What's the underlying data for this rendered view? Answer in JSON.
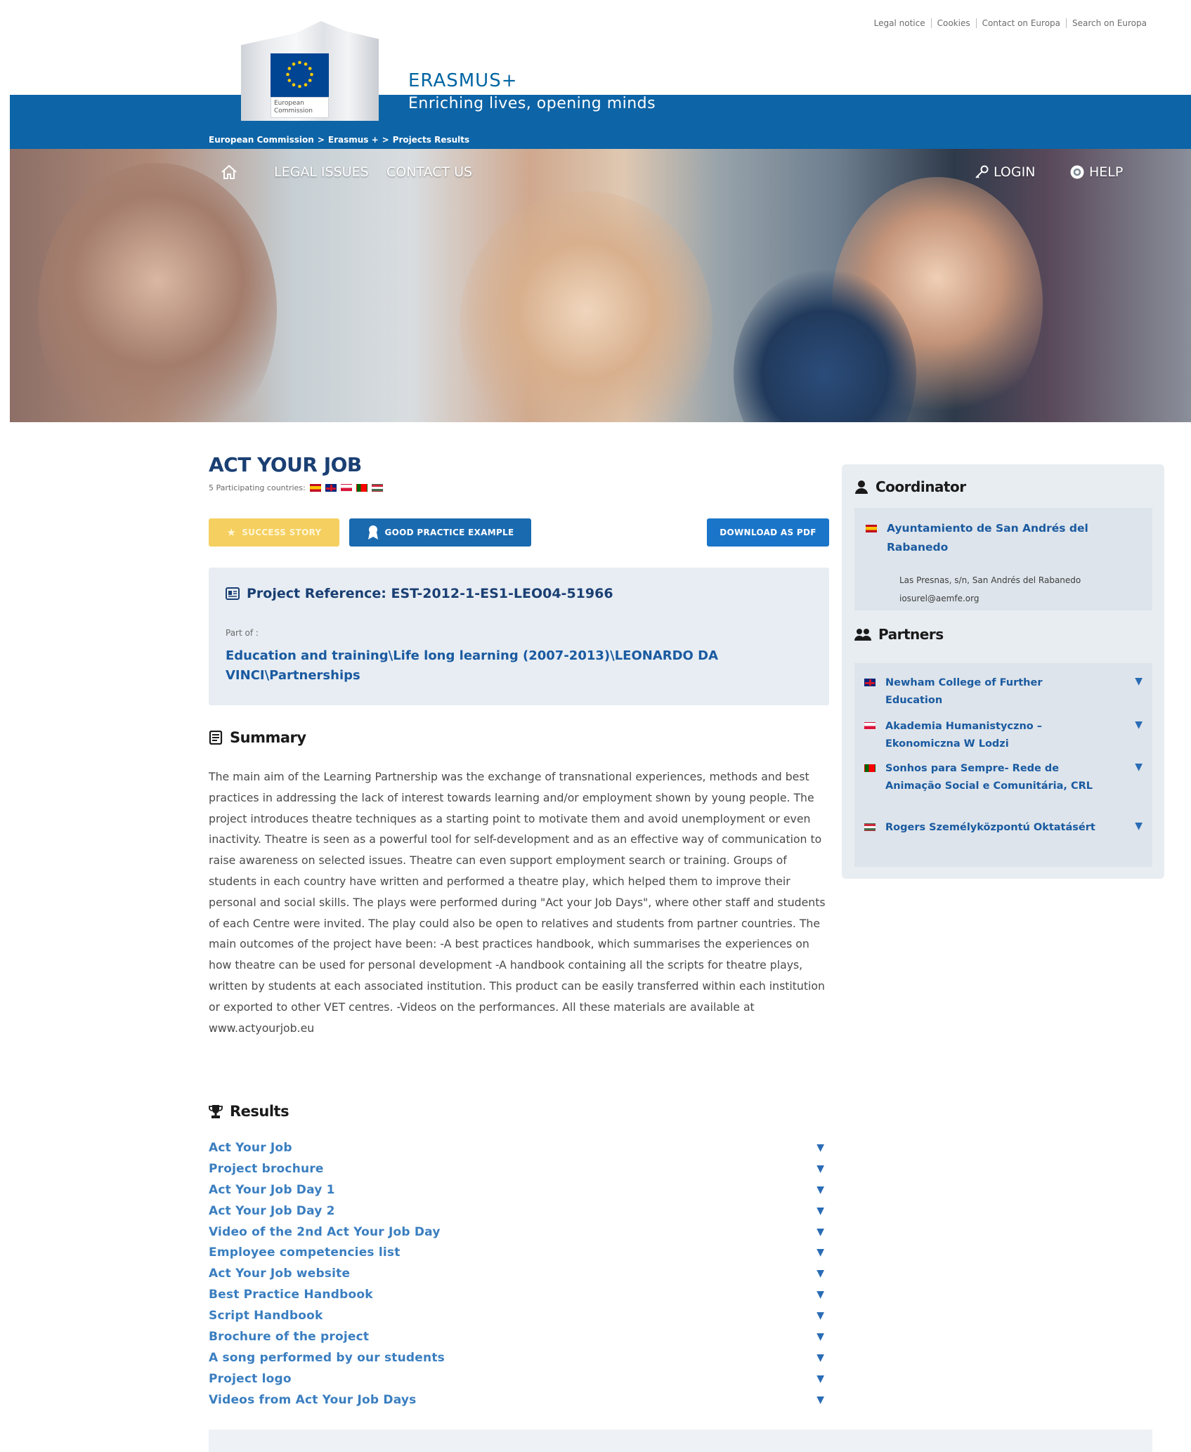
{
  "utility_links": [
    "Legal notice",
    "Cookies",
    "Contact on Europa",
    "Search on Europa"
  ],
  "logo": {
    "label_line1": "European",
    "label_line2": "Commission"
  },
  "site": {
    "title": "ERASMUS+",
    "tagline": "Enriching lives, opening minds"
  },
  "breadcrumb": [
    "European Commission",
    ">",
    "Erasmus +",
    ">",
    "Projects Results"
  ],
  "nav": {
    "legal": "LEGAL ISSUES",
    "contact": "CONTACT US",
    "login": "LOGIN",
    "help": "HELP"
  },
  "project": {
    "title": "ACT YOUR JOB",
    "countries_label": "5 Participating countries:",
    "country_flags": [
      "flag-es",
      "flag-uk",
      "flag-pl",
      "flag-pt",
      "flag-hu"
    ],
    "buttons": {
      "success": "Success story",
      "good": "Good practice example",
      "pdf": "Download as PDF"
    },
    "reference": "Project Reference: EST-2012-1-ES1-LEO04-51966",
    "part_of_label": "Part of :",
    "part_of": "Education and training\\Life long learning (2007-2013)\\LEONARDO DA VINCI\\Partnerships"
  },
  "summary": {
    "title": "Summary",
    "text": "The main aim of the Learning Partnership was the exchange of transnational experiences, methods and best practices in addressing the lack of interest towards learning and/or employment shown by young people. The project introduces theatre techniques as a starting point to motivate them and avoid unemployment or even inactivity. Theatre is seen as a powerful tool for self-development and as an effective way of communication to raise awareness on selected issues. Theatre can even support employment search or training. Groups of students in each country have written and performed a theatre play, which helped them to improve their personal and social skills. The plays were performed during \"Act your Job Days\", where other staff and students of each Centre were invited. The play could also be open to relatives and students from partner countries. The main outcomes of the project have been: -A best practices handbook, which summarises the experiences on how theatre can be used for personal development -A handbook containing all the scripts for theatre plays, written by students at each associated institution. This product can be easily transferred within each institution or exported to other VET centres. -Videos on the performances. All these materials are available at www.actyourjob.eu"
  },
  "results": {
    "title": "Results",
    "items": [
      "Act Your Job",
      "Project brochure",
      "Act Your Job Day 1",
      "Act Your Job Day 2",
      "Video of the 2nd Act Your Job Day",
      "Employee competencies list",
      "Act Your Job website",
      "Best Practice Handbook",
      "Script Handbook",
      "Brochure of the project",
      "A song performed by our students",
      "Project logo",
      "Videos from Act Your Job Days"
    ]
  },
  "coordinator": {
    "title": "Coordinator",
    "flag": "flag-es",
    "name": "Ayuntamiento de San Andrés del Rabanedo",
    "address": "Las Presnas, s/n, San Andrés del Rabanedo",
    "email": "iosurel@aemfe.org"
  },
  "partners": {
    "title": "Partners",
    "items": [
      {
        "flag": "flag-uk",
        "name": "Newham College of Further Education"
      },
      {
        "flag": "flag-pl",
        "name": "Akademia Humanistyczno – Ekonomiczna W Lodzi"
      },
      {
        "flag": "flag-pt",
        "name": "Sonhos para Sempre- Rede de Animação Social e Comunitária, CRL"
      },
      {
        "flag": "flag-hu",
        "name": "Rogers Személyközpontú Oktatásért"
      }
    ]
  },
  "colors": {
    "header_blue": "#0d64a6",
    "title_navy": "#1a3f73",
    "link_blue": "#1a5aa0",
    "success_yellow": "#f5cf5f"
  },
  "icons": {
    "arrow": "▼",
    "home": "home-icon",
    "key": "key-icon",
    "help": "help-icon",
    "star": "star-icon",
    "ribbon": "ribbon-icon",
    "reference": "id-card-icon",
    "summary": "document-icon",
    "results": "trophy-icon",
    "coordinator": "user-icon",
    "partners": "users-icon"
  }
}
